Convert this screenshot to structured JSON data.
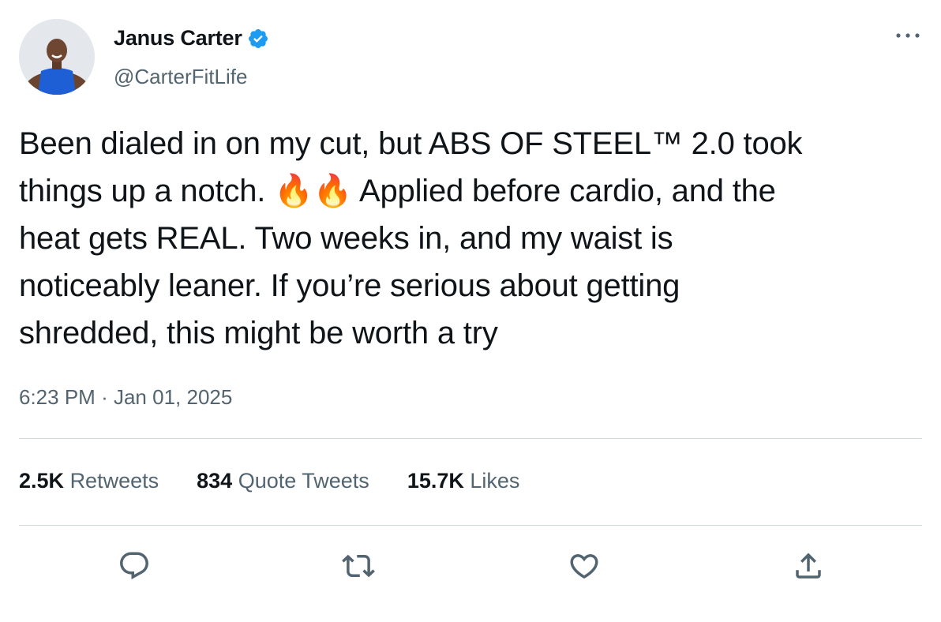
{
  "author": {
    "display_name": "Janus Carter",
    "handle": "@CarterFitLife",
    "verified": true
  },
  "tweet": {
    "text": "Been dialed in on my cut, but ABS OF STEEL™ 2.0 took\nthings up a notch. 🔥🔥 Applied before cardio, and the\nheat gets REAL. Two weeks in, and my waist is\nnoticeably leaner. If you’re serious about getting\nshredded, this might be worth a try",
    "time": "6:23 PM",
    "separator": "·",
    "date": "Jan 01, 2025"
  },
  "stats": {
    "retweets_count": "2.5K",
    "retweets_label": "Retweets",
    "quotes_count": "834",
    "quotes_label": "Quote Tweets",
    "likes_count": "15.7K",
    "likes_label": "Likes"
  },
  "icons": {
    "verified": "verified-badge-icon",
    "more": "more-dots-icon",
    "reply": "reply-icon",
    "retweet": "retweet-icon",
    "like": "heart-icon",
    "share": "share-icon"
  },
  "colors": {
    "verified_blue": "#1d9bf0",
    "text_primary": "#0f1419",
    "text_secondary": "#536471",
    "divider": "#cfd9de"
  }
}
